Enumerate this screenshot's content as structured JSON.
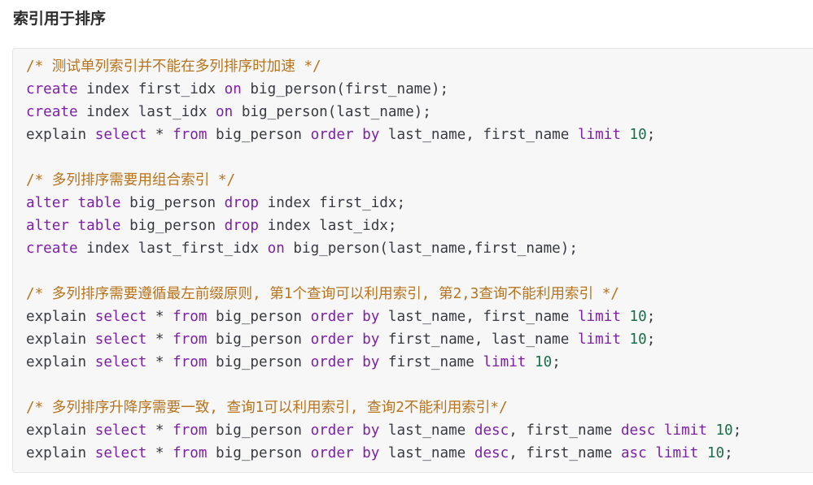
{
  "heading": "索引用于排序",
  "code_lines": [
    [
      [
        "comment",
        "/* 测试单列索引并不能在多列排序时加速 */"
      ]
    ],
    [
      [
        "keyword",
        "create"
      ],
      [
        "plain",
        " index first_idx "
      ],
      [
        "keyword",
        "on"
      ],
      [
        "plain",
        " big_person(first_name);"
      ]
    ],
    [
      [
        "keyword",
        "create"
      ],
      [
        "plain",
        " index last_idx "
      ],
      [
        "keyword",
        "on"
      ],
      [
        "plain",
        " big_person(last_name);"
      ]
    ],
    [
      [
        "plain",
        "explain "
      ],
      [
        "keyword",
        "select"
      ],
      [
        "plain",
        " * "
      ],
      [
        "keyword",
        "from"
      ],
      [
        "plain",
        " big_person "
      ],
      [
        "keyword",
        "order by"
      ],
      [
        "plain",
        " last_name, first_name "
      ],
      [
        "keyword",
        "limit"
      ],
      [
        "plain",
        " "
      ],
      [
        "number",
        "10"
      ],
      [
        "plain",
        ";"
      ]
    ],
    [],
    [
      [
        "comment",
        "/* 多列排序需要用组合索引 */"
      ]
    ],
    [
      [
        "keyword",
        "alter table"
      ],
      [
        "plain",
        " big_person "
      ],
      [
        "keyword",
        "drop"
      ],
      [
        "plain",
        " index first_idx;"
      ]
    ],
    [
      [
        "keyword",
        "alter table"
      ],
      [
        "plain",
        " big_person "
      ],
      [
        "keyword",
        "drop"
      ],
      [
        "plain",
        " index last_idx;"
      ]
    ],
    [
      [
        "keyword",
        "create"
      ],
      [
        "plain",
        " index last_first_idx "
      ],
      [
        "keyword",
        "on"
      ],
      [
        "plain",
        " big_person(last_name,first_name);"
      ]
    ],
    [],
    [
      [
        "comment",
        "/* 多列排序需要遵循最左前缀原则, 第1个查询可以利用索引, 第2,3查询不能利用索引 */"
      ]
    ],
    [
      [
        "plain",
        "explain "
      ],
      [
        "keyword",
        "select"
      ],
      [
        "plain",
        " * "
      ],
      [
        "keyword",
        "from"
      ],
      [
        "plain",
        " big_person "
      ],
      [
        "keyword",
        "order by"
      ],
      [
        "plain",
        " last_name, first_name "
      ],
      [
        "keyword",
        "limit"
      ],
      [
        "plain",
        " "
      ],
      [
        "number",
        "10"
      ],
      [
        "plain",
        ";"
      ]
    ],
    [
      [
        "plain",
        "explain "
      ],
      [
        "keyword",
        "select"
      ],
      [
        "plain",
        " * "
      ],
      [
        "keyword",
        "from"
      ],
      [
        "plain",
        " big_person "
      ],
      [
        "keyword",
        "order by"
      ],
      [
        "plain",
        " first_name, last_name "
      ],
      [
        "keyword",
        "limit"
      ],
      [
        "plain",
        " "
      ],
      [
        "number",
        "10"
      ],
      [
        "plain",
        ";"
      ]
    ],
    [
      [
        "plain",
        "explain "
      ],
      [
        "keyword",
        "select"
      ],
      [
        "plain",
        " * "
      ],
      [
        "keyword",
        "from"
      ],
      [
        "plain",
        " big_person "
      ],
      [
        "keyword",
        "order by"
      ],
      [
        "plain",
        " first_name "
      ],
      [
        "keyword",
        "limit"
      ],
      [
        "plain",
        " "
      ],
      [
        "number",
        "10"
      ],
      [
        "plain",
        ";"
      ]
    ],
    [],
    [
      [
        "comment",
        "/* 多列排序升降序需要一致, 查询1可以利用索引, 查询2不能利用索引*/"
      ]
    ],
    [
      [
        "plain",
        "explain "
      ],
      [
        "keyword",
        "select"
      ],
      [
        "plain",
        " * "
      ],
      [
        "keyword",
        "from"
      ],
      [
        "plain",
        " big_person "
      ],
      [
        "keyword",
        "order by"
      ],
      [
        "plain",
        " last_name "
      ],
      [
        "keyword",
        "desc"
      ],
      [
        "plain",
        ", first_name "
      ],
      [
        "keyword",
        "desc"
      ],
      [
        "plain",
        " "
      ],
      [
        "keyword",
        "limit"
      ],
      [
        "plain",
        " "
      ],
      [
        "number",
        "10"
      ],
      [
        "plain",
        ";"
      ]
    ],
    [
      [
        "plain",
        "explain "
      ],
      [
        "keyword",
        "select"
      ],
      [
        "plain",
        " * "
      ],
      [
        "keyword",
        "from"
      ],
      [
        "plain",
        " big_person "
      ],
      [
        "keyword",
        "order by"
      ],
      [
        "plain",
        " last_name "
      ],
      [
        "keyword",
        "desc"
      ],
      [
        "plain",
        ", first_name "
      ],
      [
        "keyword",
        "asc"
      ],
      [
        "plain",
        " "
      ],
      [
        "keyword",
        "limit"
      ],
      [
        "plain",
        " "
      ],
      [
        "number",
        "10"
      ],
      [
        "plain",
        ";"
      ]
    ]
  ]
}
